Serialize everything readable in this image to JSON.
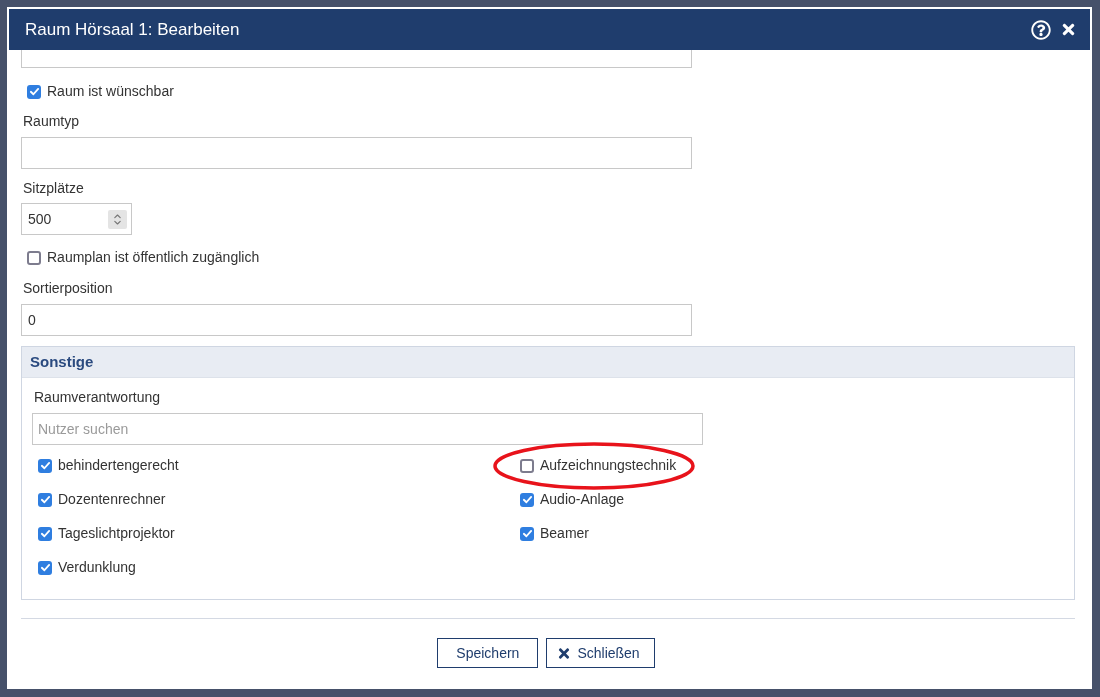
{
  "dialog": {
    "title": "Raum Hörsaal 1: Bearbeiten"
  },
  "fields": [
    {
      "kind": "partial"
    },
    {
      "kind": "checkbox",
      "label": "Raum ist wünschbar",
      "checked": true
    },
    {
      "kind": "text",
      "label": "Raumtyp"
    },
    {
      "kind": "number",
      "label": "Sitzplätze",
      "value": "500"
    },
    {
      "kind": "checkbox",
      "label": "Raumplan ist öffentlich zugänglich",
      "checked": false
    },
    {
      "kind": "text",
      "label": "Sortierposition",
      "value": "0"
    }
  ],
  "section": {
    "title": "Sonstige",
    "search": {
      "label": "Raumverantwortung",
      "placeholder": "Nutzer suchen"
    },
    "columns": [
      {
        "options": [
          {
            "label": "behindertengerecht",
            "checked": true,
            "highlighted": false
          },
          {
            "label": "Dozentenrechner",
            "checked": true,
            "highlighted": false
          },
          {
            "label": "Tageslichtprojektor",
            "checked": true,
            "highlighted": false
          },
          {
            "label": "Verdunklung",
            "checked": true,
            "highlighted": false
          }
        ]
      },
      {
        "options": [
          {
            "label": "Aufzeichnungstechnik",
            "checked": false,
            "highlighted": true
          },
          {
            "label": "Audio-Anlage",
            "checked": true,
            "highlighted": false
          },
          {
            "label": "Beamer",
            "checked": true,
            "highlighted": false
          }
        ]
      }
    ]
  },
  "buttons": [
    {
      "label": "Speichern",
      "kind": "save"
    },
    {
      "label": "Schließen",
      "kind": "close"
    }
  ]
}
